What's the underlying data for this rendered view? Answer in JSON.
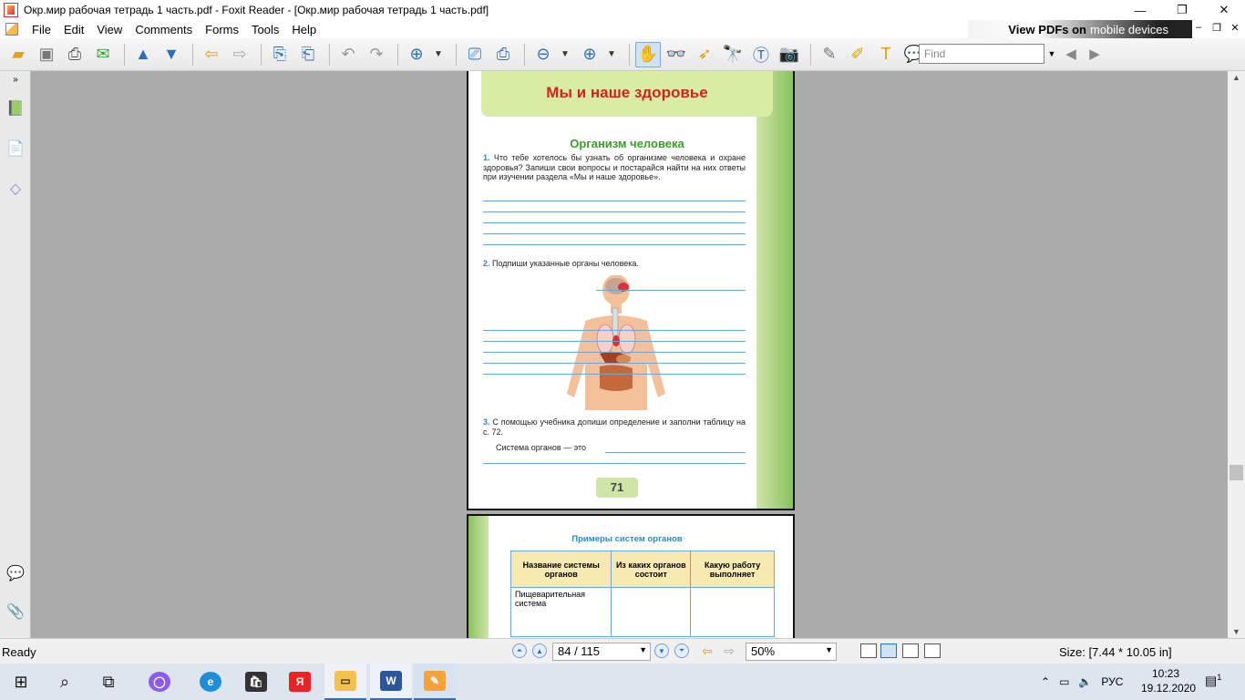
{
  "window": {
    "title": "Окр.мир рабочая тетрадь 1 часть.pdf - Foxit Reader - [Окр.мир рабочая тетрадь 1 часть.pdf]",
    "minimize": "—",
    "maximize": "❐",
    "close": "✕"
  },
  "menu": {
    "items": [
      "File",
      "Edit",
      "View",
      "Comments",
      "Forms",
      "Tools",
      "Help"
    ],
    "ad_text_1": "View PDFs on",
    "ad_text_2": "mobile devices"
  },
  "find": {
    "placeholder": "Find"
  },
  "document": {
    "page1": {
      "header": "Мы и наше здоровье",
      "subtitle": "Организм человека",
      "task1_num": "1.",
      "task1": "Что тебе хотелось бы узнать об организме человека и охране здоровья? Запиши свои вопросы и постарайся найти на них ответы при изучении раздела «Мы и наше здоровье».",
      "task2_num": "2.",
      "task2": "Подпиши указанные органы человека.",
      "task3_num": "3.",
      "task3": "С помощью учебника допиши определение и заполни таблицу на с. 72.",
      "definition": "Система органов — это",
      "page_number": "71"
    },
    "page2": {
      "table_title": "Примеры систем органов",
      "columns": [
        "Название системы органов",
        "Из каких органов состоит",
        "Какую работу выполняет"
      ],
      "rows": [
        [
          "Пищеварительная система",
          "",
          ""
        ]
      ]
    }
  },
  "status": {
    "ready": "Ready",
    "page": "84 / 115",
    "zoom": "50%",
    "size": "Size: [7.44 * 10.05 in]"
  },
  "taskbar": {
    "lang": "РУС",
    "time": "10:23",
    "date": "19.12.2020",
    "notif_count": "1"
  }
}
